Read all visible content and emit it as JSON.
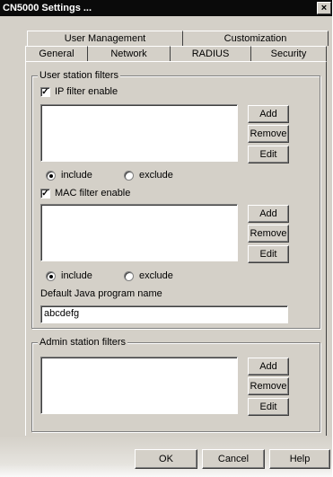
{
  "window": {
    "title": "CN5000 Settings ...",
    "close_glyph": "×"
  },
  "tabs": {
    "row1": [
      "User Management",
      "Customization"
    ],
    "row2": [
      "General",
      "Network",
      "RADIUS",
      "Security"
    ],
    "active": "Security"
  },
  "user_filters": {
    "legend": "User station filters",
    "ip": {
      "label": "IP filter enable",
      "checked": true,
      "add": "Add",
      "remove": "Remove",
      "edit": "Edit",
      "include": "include",
      "exclude": "exclude",
      "mode": "include"
    },
    "mac": {
      "label": "MAC filter enable",
      "checked": true,
      "add": "Add",
      "remove": "Remove",
      "edit": "Edit",
      "include": "include",
      "exclude": "exclude",
      "mode": "include"
    },
    "java_label": "Default Java program name",
    "java_value": "abcdefg"
  },
  "admin_filters": {
    "legend": "Admin station filters",
    "add": "Add",
    "remove": "Remove",
    "edit": "Edit"
  },
  "footer": {
    "ok": "OK",
    "cancel": "Cancel",
    "help": "Help"
  }
}
